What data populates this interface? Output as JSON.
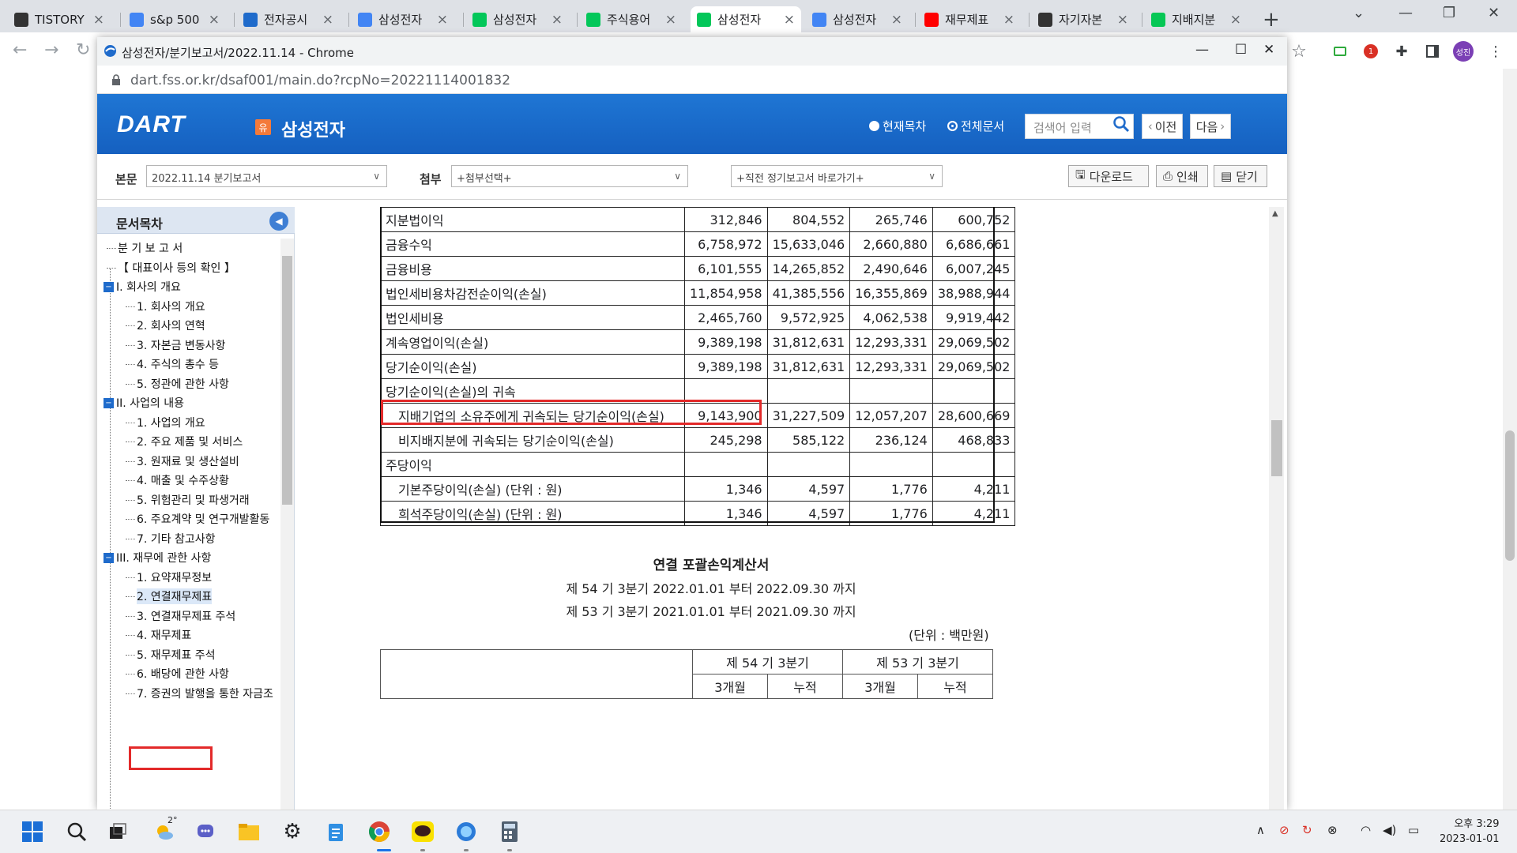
{
  "browser": {
    "tabs": [
      {
        "label": "TISTORY",
        "icon": "tistory-icon",
        "color": "#333333"
      },
      {
        "label": "s&p 500",
        "icon": "google-icon",
        "color": "#4285f4"
      },
      {
        "label": "전자공시",
        "icon": "dart-icon",
        "color": "#1f6bcb"
      },
      {
        "label": "삼성전자",
        "icon": "google-icon",
        "color": "#4285f4"
      },
      {
        "label": "삼성전자",
        "icon": "naver-icon",
        "color": "#03c75a"
      },
      {
        "label": "주식용어",
        "icon": "blog-icon",
        "color": "#03c75a"
      },
      {
        "label": "삼성전자",
        "icon": "finance-icon",
        "color": "#03c75a",
        "active": true
      },
      {
        "label": "삼성전자",
        "icon": "google-icon",
        "color": "#4285f4"
      },
      {
        "label": "재무제표",
        "icon": "youtube-icon",
        "color": "#ff0000"
      },
      {
        "label": "자기자본",
        "icon": "tistory-icon",
        "color": "#333333"
      },
      {
        "label": "지배지분",
        "icon": "line-icon",
        "color": "#06c755"
      }
    ],
    "profile_initials": "성진"
  },
  "popup": {
    "title": "삼성전자/분기보고서/2022.11.14 - Chrome",
    "url": "dart.fss.or.kr/dsaf001/main.do?rcpNo=20221114001832"
  },
  "dart": {
    "logo": "DART",
    "badge": "유",
    "company": "삼성전자",
    "radio_toc": "현재목차",
    "radio_all": "전체문서",
    "search_placeholder": "검색어 입력",
    "prev": "이전",
    "next": "다음",
    "body_label": "본문",
    "body_select": "2022.11.14  분기보고서",
    "attach_label": "첨부",
    "attach_select": "+첨부선택+",
    "recent_select": "+직전 정기보고서 바로가기+",
    "download": "다운로드",
    "print": "인쇄",
    "close": "닫기"
  },
  "toc": {
    "title": "문서목차",
    "items": [
      {
        "label": "분 기 보 고 서",
        "level": 0
      },
      {
        "label": "【 대표이사 등의 확인 】",
        "level": 0
      },
      {
        "label": "I. 회사의 개요",
        "level": 0,
        "folder": true
      },
      {
        "label": "1. 회사의 개요",
        "level": 1
      },
      {
        "label": "2. 회사의 연혁",
        "level": 1
      },
      {
        "label": "3. 자본금 변동사항",
        "level": 1
      },
      {
        "label": "4. 주식의 총수 등",
        "level": 1
      },
      {
        "label": "5. 정관에 관한 사항",
        "level": 1
      },
      {
        "label": "II. 사업의 내용",
        "level": 0,
        "folder": true
      },
      {
        "label": "1. 사업의 개요",
        "level": 1
      },
      {
        "label": "2. 주요 제품 및 서비스",
        "level": 1
      },
      {
        "label": "3. 원재료 및 생산설비",
        "level": 1
      },
      {
        "label": "4. 매출 및 수주상황",
        "level": 1
      },
      {
        "label": "5. 위험관리 및 파생거래",
        "level": 1
      },
      {
        "label": "6. 주요계약 및 연구개발활동",
        "level": 1
      },
      {
        "label": "7. 기타 참고사항",
        "level": 1
      },
      {
        "label": "III. 재무에 관한 사항",
        "level": 0,
        "folder": true
      },
      {
        "label": "1. 요약재무정보",
        "level": 1
      },
      {
        "label": "2. 연결재무제표",
        "level": 1,
        "selected": true
      },
      {
        "label": "3. 연결재무제표 주석",
        "level": 1
      },
      {
        "label": "4. 재무제표",
        "level": 1
      },
      {
        "label": "5. 재무제표 주석",
        "level": 1
      },
      {
        "label": "6. 배당에 관한 사항",
        "level": 1
      },
      {
        "label": "7. 증권의 발행을 통한 자금조",
        "level": 1
      }
    ]
  },
  "statement": {
    "rows": [
      {
        "label": "지분법이익",
        "v": [
          "312,846",
          "804,552",
          "265,746",
          "600,752"
        ]
      },
      {
        "label": "금융수익",
        "v": [
          "6,758,972",
          "15,633,046",
          "2,660,880",
          "6,686,661"
        ]
      },
      {
        "label": "금융비용",
        "v": [
          "6,101,555",
          "14,265,852",
          "2,490,646",
          "6,007,245"
        ]
      },
      {
        "label": "법인세비용차감전순이익(손실)",
        "v": [
          "11,854,958",
          "41,385,556",
          "16,355,869",
          "38,988,944"
        ]
      },
      {
        "label": "법인세비용",
        "v": [
          "2,465,760",
          "9,572,925",
          "4,062,538",
          "9,919,442"
        ]
      },
      {
        "label": "계속영업이익(손실)",
        "v": [
          "9,389,198",
          "31,812,631",
          "12,293,331",
          "29,069,502"
        ]
      },
      {
        "label": "당기순이익(손실)",
        "v": [
          "9,389,198",
          "31,812,631",
          "12,293,331",
          "29,069,502"
        ]
      },
      {
        "label": "당기순이익(손실)의 귀속",
        "v": [
          "",
          "",
          "",
          ""
        ]
      },
      {
        "label": "지배기업의 소유주에게 귀속되는 당기순이익(손실)",
        "v": [
          "9,143,900",
          "31,227,509",
          "12,057,207",
          "28,600,669"
        ],
        "indent": true,
        "highlight": true
      },
      {
        "label": "비지배지분에 귀속되는 당기순이익(손실)",
        "v": [
          "245,298",
          "585,122",
          "236,124",
          "468,833"
        ],
        "indent": true
      },
      {
        "label": "주당이익",
        "v": [
          "",
          "",
          "",
          ""
        ]
      },
      {
        "label": "기본주당이익(손실) (단위 : 원)",
        "v": [
          "1,346",
          "4,597",
          "1,776",
          "4,211"
        ],
        "indent": true
      },
      {
        "label": "희석주당이익(손실) (단위 : 원)",
        "v": [
          "1,346",
          "4,597",
          "1,776",
          "4,211"
        ],
        "indent": true
      }
    ],
    "next_title": "연결 포괄손익계산서",
    "period1": "제 54 기 3분기 2022.01.01 부터 2022.09.30 까지",
    "period2": "제 53 기 3분기 2021.01.01 부터 2021.09.30 까지",
    "unit": "(단위 : 백만원)",
    "h_54": "제 54 기 3분기",
    "h_53": "제 53 기 3분기",
    "h_3m": "3개월",
    "h_cum": "누적"
  },
  "taskbar": {
    "weather": "2°",
    "time": "오후 3:29",
    "date": "2023-01-01"
  }
}
